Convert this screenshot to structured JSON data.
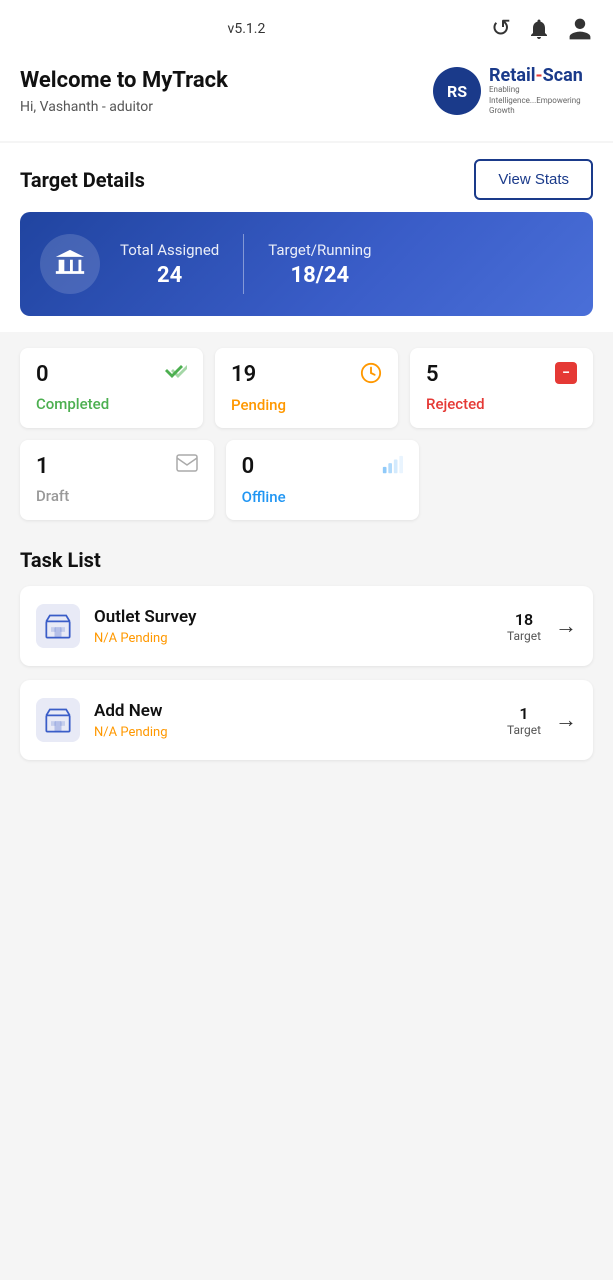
{
  "topbar": {
    "version": "v5.1.2",
    "refresh_icon": "↻",
    "bell_icon": "🔔",
    "user_icon": "👤"
  },
  "header": {
    "welcome_title": "Welcome to MyTrack",
    "welcome_subtitle": "Hi, Vashanth - aduitor",
    "logo_initials": "RS",
    "logo_brand": "Retail",
    "logo_dash": "-",
    "logo_scan": "Scan",
    "logo_tagline": "Enabling Intelligence...Empowering Growth"
  },
  "target": {
    "title": "Target Details",
    "view_stats_label": "View Stats",
    "total_assigned_label": "Total Assigned",
    "total_assigned_value": "24",
    "target_running_label": "Target/Running",
    "target_running_value": "18/24"
  },
  "stats_cards": [
    {
      "number": "0",
      "label": "Completed",
      "color": "green",
      "icon_type": "double-check"
    },
    {
      "number": "19",
      "label": "Pending",
      "color": "orange",
      "icon_type": "clock"
    },
    {
      "number": "5",
      "label": "Rejected",
      "color": "red",
      "icon_type": "minus-red"
    },
    {
      "number": "1",
      "label": "Draft",
      "color": "gray",
      "icon_type": "envelope"
    },
    {
      "number": "0",
      "label": "Offline",
      "color": "blue",
      "icon_type": "signal"
    }
  ],
  "task_list": {
    "title": "Task List",
    "tasks": [
      {
        "name": "Outlet Survey",
        "status": "N/A Pending",
        "target_num": "18",
        "target_label": "Target"
      },
      {
        "name": "Add New",
        "status": "N/A Pending",
        "target_num": "1",
        "target_label": "Target"
      }
    ]
  }
}
